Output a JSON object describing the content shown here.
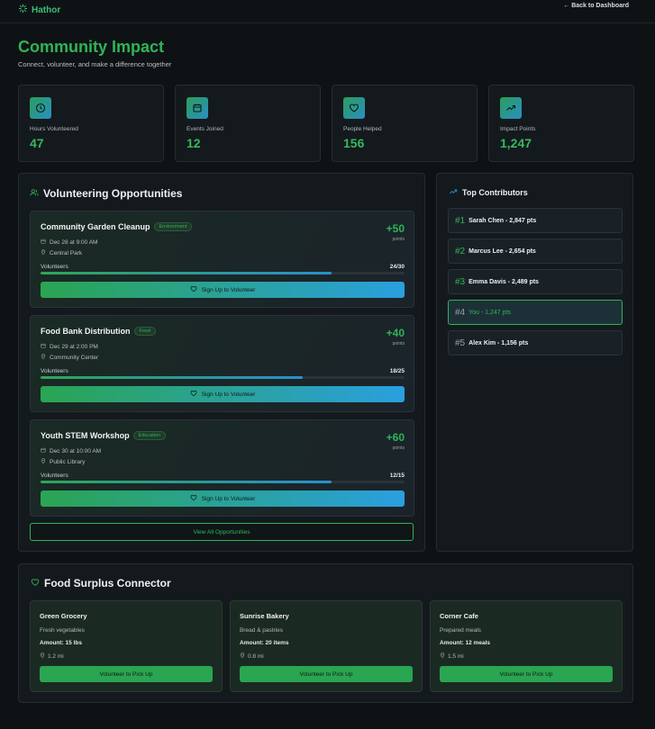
{
  "header": {
    "brand": "Hathor",
    "back_link": "← Back to Dashboard"
  },
  "page": {
    "title": "Community Impact",
    "subtitle": "Connect, volunteer, and make a difference together"
  },
  "stats": [
    {
      "label": "Hours Volunteered",
      "value": "47",
      "icon": "clock-icon"
    },
    {
      "label": "Events Joined",
      "value": "12",
      "icon": "calendar-icon"
    },
    {
      "label": "People Helped",
      "value": "156",
      "icon": "heart-icon"
    },
    {
      "label": "Impact Points",
      "value": "1,247",
      "icon": "trending-up-icon"
    }
  ],
  "opportunities": {
    "title": "Volunteering Opportunities",
    "view_all_label": "View All Opportunities",
    "points_label": "points",
    "volunteers_label": "Volunteers",
    "signup_label": "Sign Up to Volunteer",
    "items": [
      {
        "title": "Community Garden Cleanup",
        "tag": "Environment",
        "points": "+50",
        "date": "Dec 28 at 9:00 AM",
        "location": "Central Park",
        "count": "24/30",
        "fill": 0.8
      },
      {
        "title": "Food Bank Distribution",
        "tag": "Food",
        "points": "+40",
        "date": "Dec 29 at 2:00 PM",
        "location": "Community Center",
        "count": "18/25",
        "fill": 0.72
      },
      {
        "title": "Youth STEM Workshop",
        "tag": "Education",
        "points": "+60",
        "date": "Dec 30 at 10:00 AM",
        "location": "Public Library",
        "count": "12/15",
        "fill": 0.8
      }
    ]
  },
  "contributors": {
    "title": "Top Contributors",
    "items": [
      {
        "rank": "#1",
        "label": "Sarah Chen - 2,847 pts"
      },
      {
        "rank": "#2",
        "label": "Marcus Lee - 2,654 pts"
      },
      {
        "rank": "#3",
        "label": "Emma Davis - 2,489 pts"
      },
      {
        "rank": "#4",
        "label": "You - 1,247 pts"
      },
      {
        "rank": "#5",
        "label": "Alex Kim - 1,156 pts"
      }
    ]
  },
  "food": {
    "title": "Food Surplus Connector",
    "amount_prefix": "Amount:",
    "pickup_label": "Volunteer to Pick Up",
    "items": [
      {
        "name": "Green Grocery",
        "desc": "Fresh vegetables",
        "amount": "Amount: 15 lbs",
        "distance": "1.2 mi"
      },
      {
        "name": "Sunrise Bakery",
        "desc": "Bread & pastries",
        "amount": "Amount: 20 items",
        "distance": "0.8 mi"
      },
      {
        "name": "Corner Cafe",
        "desc": "Prepared meals",
        "amount": "Amount: 12 meals",
        "distance": "1.5 mi"
      }
    ]
  },
  "colors": {
    "accent": "#2fb457",
    "accent_blue": "#2a9fdf",
    "background": "#0f1215",
    "card": "#14191d"
  }
}
